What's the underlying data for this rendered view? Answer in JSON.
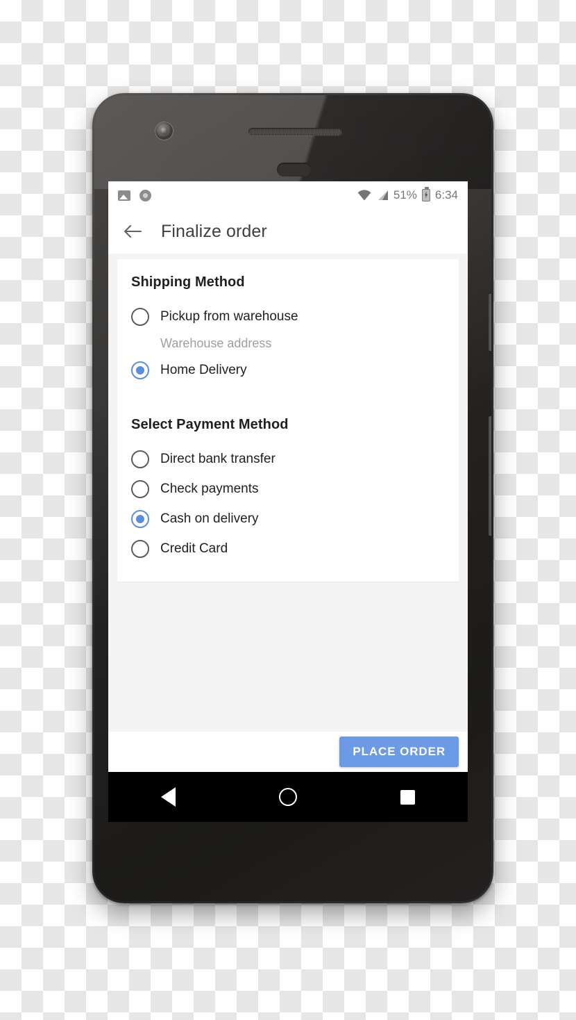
{
  "status_bar": {
    "left_icons": [
      "image-icon",
      "disc-icon"
    ],
    "right_icons": [
      "wifi-icon",
      "signal-icon",
      "battery-charging-icon"
    ],
    "battery_percent": "51%",
    "time": "6:34"
  },
  "toolbar": {
    "back_icon": "back-arrow-icon",
    "title": "Finalize order"
  },
  "shipping": {
    "title": "Shipping Method",
    "options": [
      {
        "label": "Pickup from warehouse",
        "selected": false,
        "note": "Warehouse address"
      },
      {
        "label": "Home Delivery",
        "selected": true,
        "note": ""
      }
    ]
  },
  "payment": {
    "title": "Select Payment Method",
    "options": [
      {
        "label": "Direct bank transfer",
        "selected": false
      },
      {
        "label": "Check payments",
        "selected": false
      },
      {
        "label": "Cash on delivery",
        "selected": true
      },
      {
        "label": "Credit Card",
        "selected": false
      }
    ]
  },
  "action_bar": {
    "place_order_label": "PLACE ORDER"
  },
  "nav_bar": {
    "back": "nav-back-icon",
    "home": "nav-home-icon",
    "recents": "nav-recents-icon"
  },
  "colors": {
    "accent": "#5b8fdb",
    "button": "#6d9ae4",
    "screen_bg": "#f5f4f4",
    "surface": "#ffffff",
    "text_primary": "#202124",
    "text_muted": "#9aa0a6"
  }
}
